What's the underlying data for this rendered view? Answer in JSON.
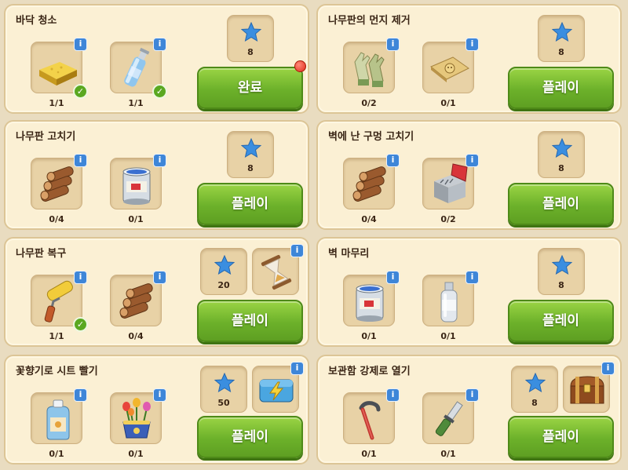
{
  "colors": {
    "card_bg": "#fbf0d4",
    "button_green": "#6cb12a",
    "info_blue": "#3e86d8",
    "check_green": "#5aa820",
    "star_blue": "#3a8ee0",
    "notif_red": "#e02a1a"
  },
  "info_glyph": "i",
  "check_glyph": "✓",
  "tasks": [
    {
      "title": "바닥 청소",
      "items": [
        {
          "icon": "sponge-icon",
          "count": "1/1",
          "done": true
        },
        {
          "icon": "spray-bottle-icon",
          "count": "1/1",
          "done": true
        }
      ],
      "stars": "8",
      "button": "완료",
      "notification": true
    },
    {
      "title": "나무판의 먼지 제거",
      "items": [
        {
          "icon": "gloves-icon",
          "count": "0/2"
        },
        {
          "icon": "sandpaper-icon",
          "count": "0/1"
        }
      ],
      "stars": "8",
      "button": "플레이"
    },
    {
      "title": "나무판 고치기",
      "items": [
        {
          "icon": "logs-icon",
          "count": "0/4"
        },
        {
          "icon": "paint-can-icon",
          "count": "0/1"
        }
      ],
      "stars": "8",
      "button": "플레이"
    },
    {
      "title": "벽에 난 구멍 고치기",
      "items": [
        {
          "icon": "logs-icon",
          "count": "0/4"
        },
        {
          "icon": "nails-box-icon",
          "count": "0/2"
        }
      ],
      "stars": "8",
      "button": "플레이"
    },
    {
      "title": "나무판 복구",
      "items": [
        {
          "icon": "paint-roller-icon",
          "count": "1/1",
          "done": true
        },
        {
          "icon": "logs-icon",
          "count": "0/4"
        }
      ],
      "stars": "20",
      "bonus": "hourglass-icon",
      "button": "플레이"
    },
    {
      "title": "벽 마무리",
      "items": [
        {
          "icon": "paint-can-icon",
          "count": "0/1"
        },
        {
          "icon": "plastic-bottle-icon",
          "count": "0/1"
        }
      ],
      "stars": "8",
      "button": "플레이"
    },
    {
      "title": "꽃향기로 시트 빨기",
      "items": [
        {
          "icon": "detergent-bottle-icon",
          "count": "0/1"
        },
        {
          "icon": "flower-pot-icon",
          "count": "0/1"
        }
      ],
      "stars": "50",
      "bonus": "lightning-box-icon",
      "button": "플레이"
    },
    {
      "title": "보관함 강제로 열기",
      "items": [
        {
          "icon": "crowbar-icon",
          "count": "0/1"
        },
        {
          "icon": "knife-icon",
          "count": "0/1"
        }
      ],
      "stars": "8",
      "bonus": "treasure-chest-icon",
      "button": "플레이"
    }
  ]
}
